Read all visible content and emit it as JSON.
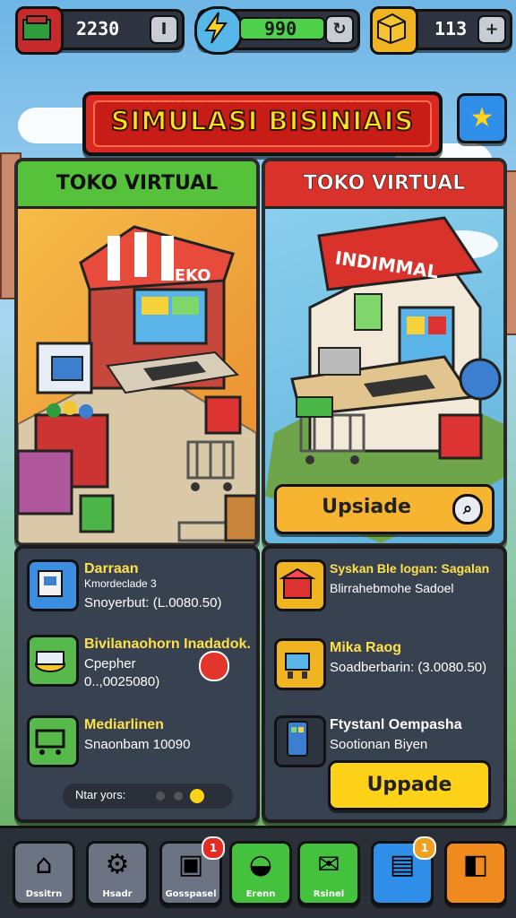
{
  "resources": [
    {
      "value": "2230",
      "button": "I",
      "icon": "cash-icon",
      "color": "#c62a2a"
    },
    {
      "value": "990",
      "button": "↻",
      "icon": "energy-icon",
      "color": "#4fd14b"
    },
    {
      "value": "113",
      "button": "+",
      "icon": "box-icon",
      "color": "#f0b422"
    }
  ],
  "title": "SIMULASI BISINIAIS",
  "stores": {
    "left": {
      "header": "TOKO VIRTUAL",
      "sign": "IEKO"
    },
    "right": {
      "header": "TOKO VIRTUAL",
      "sign": "INDIMMAL",
      "upgrade_label": "Upsiade"
    }
  },
  "left_panel": {
    "rows": [
      {
        "title": "Darraan",
        "line2": "Kmordeclade 3",
        "line3": "Snoyerbut: (L.0080.50)"
      },
      {
        "title": "Bivilanaohorn Inadadok.",
        "line2": "Cpepher",
        "line3": "0..,0025080)"
      },
      {
        "title": "Mediarlinen",
        "line2": "Snaonbam 10090",
        "line3": ""
      }
    ],
    "footer_label": "Ntar yors:"
  },
  "right_panel": {
    "rows": [
      {
        "title": "Syskan Ble logan: Sagalan",
        "line2": "Blirrahebmohe Sadoel",
        "line3": ""
      },
      {
        "title": "Mika Raog",
        "line2": "Soadberbarin: (3.0080.50)",
        "line3": ""
      },
      {
        "title": "Ftystanl Oempasha",
        "line2": "Sootionan Biyen",
        "line3": ""
      }
    ],
    "upgrade_label": "Uppade"
  },
  "nav": [
    {
      "label": "Dssitrn",
      "icon": "home-icon",
      "color": "#6c7382"
    },
    {
      "label": "Hsadr",
      "icon": "gear-icon",
      "color": "#6c7382"
    },
    {
      "label": "Gosspasel",
      "icon": "inventory-icon",
      "color": "#6c7382",
      "badge": "1"
    },
    {
      "label": "Erenn",
      "icon": "bowl-icon",
      "color": "#45c23d"
    },
    {
      "label": "Rsinel",
      "icon": "chat-icon",
      "color": "#45c23d"
    },
    {
      "label": "",
      "icon": "gift-icon",
      "color": "#2f8ee8",
      "badge": "1"
    },
    {
      "label": "",
      "icon": "bag-icon",
      "color": "#f08a1e"
    }
  ]
}
